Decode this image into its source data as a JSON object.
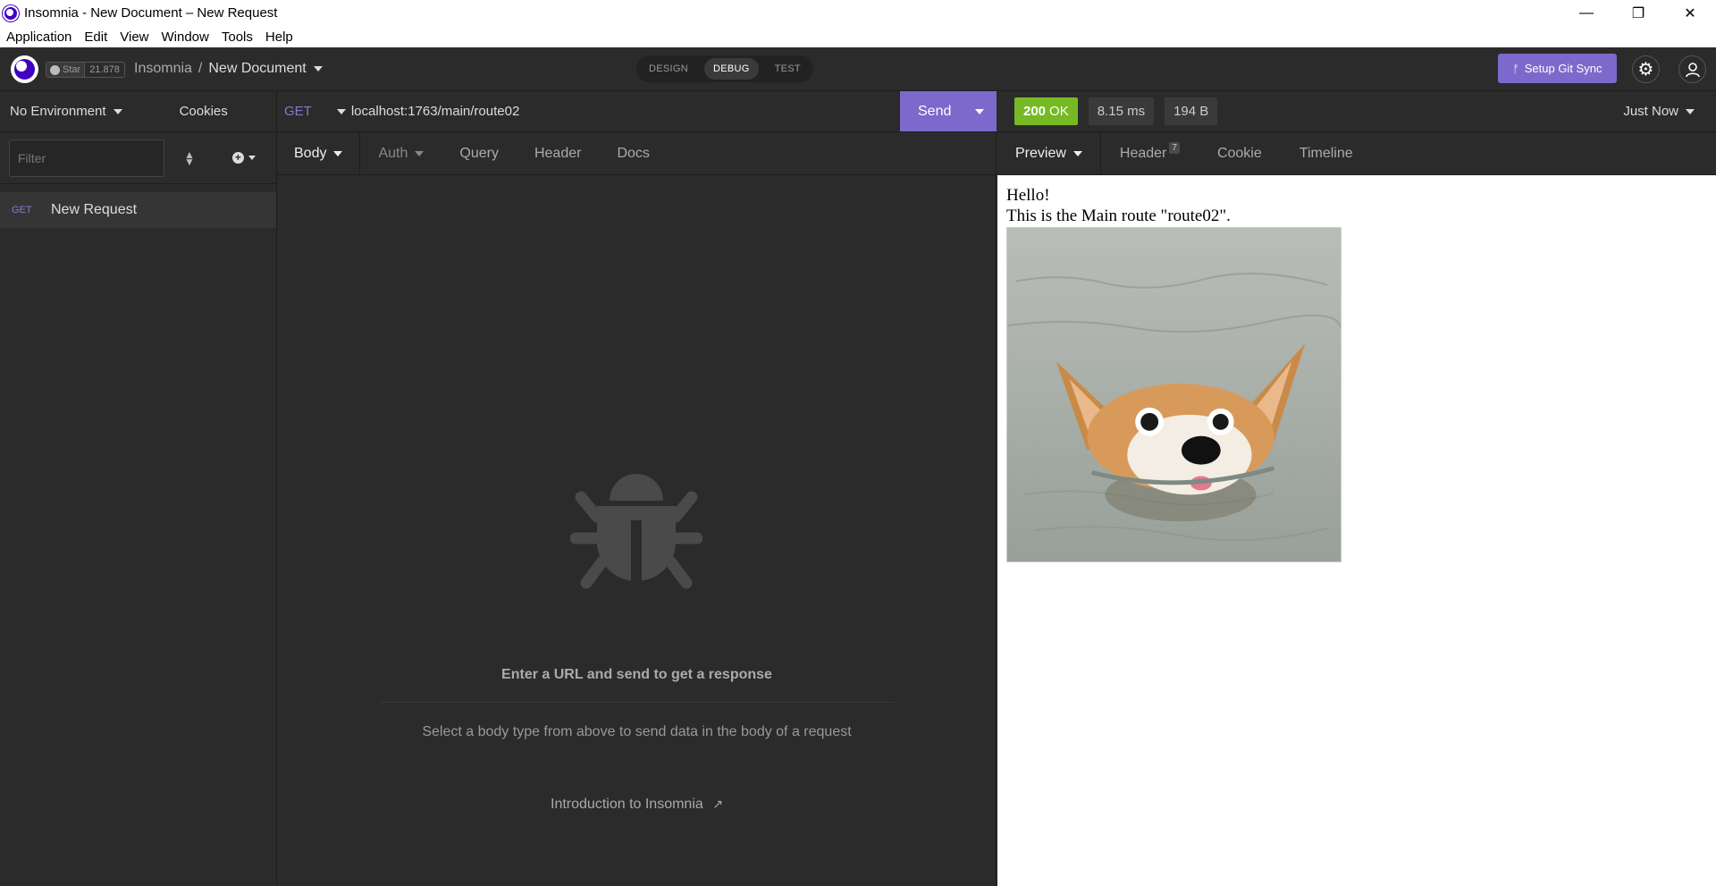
{
  "window": {
    "title": "Insomnia - New Document – New Request",
    "minimize": "—",
    "restore": "❐",
    "close": "✕"
  },
  "menu": [
    "Application",
    "Edit",
    "View",
    "Window",
    "Tools",
    "Help"
  ],
  "header": {
    "star_label": "Star",
    "star_count": "21.878",
    "breadcrumb_root": "Insomnia",
    "breadcrumb_sep": "/",
    "breadcrumb_doc": "New Document",
    "modes": [
      "DESIGN",
      "DEBUG",
      "TEST"
    ],
    "active_mode": "DEBUG",
    "git_sync_label": "Setup Git Sync",
    "settings_glyph": "⚙"
  },
  "sidebar": {
    "environment": "No Environment",
    "cookies": "Cookies",
    "filter_placeholder": "Filter",
    "requests": [
      {
        "method": "GET",
        "name": "New Request"
      }
    ]
  },
  "request": {
    "method": "GET",
    "url": "localhost:1763/main/route02",
    "send_label": "Send",
    "tabs": [
      "Body",
      "Auth",
      "Query",
      "Header",
      "Docs"
    ],
    "empty_title": "Enter a URL and send to get a response",
    "empty_hint": "Select a body type from above to send data in the body of a request",
    "intro_link": "Introduction to Insomnia"
  },
  "response": {
    "status_code": "200",
    "status_text": "OK",
    "time": "8.15 ms",
    "size": "194 B",
    "when": "Just Now",
    "tabs": [
      "Preview",
      "Header",
      "Cookie",
      "Timeline"
    ],
    "header_count": "7",
    "preview_line1": "Hello!",
    "preview_line2": "This is the Main route \"route02\"."
  },
  "colors": {
    "accent": "#7d69cb",
    "status_ok": "#75ba24",
    "method_get": "#8a77d4"
  }
}
